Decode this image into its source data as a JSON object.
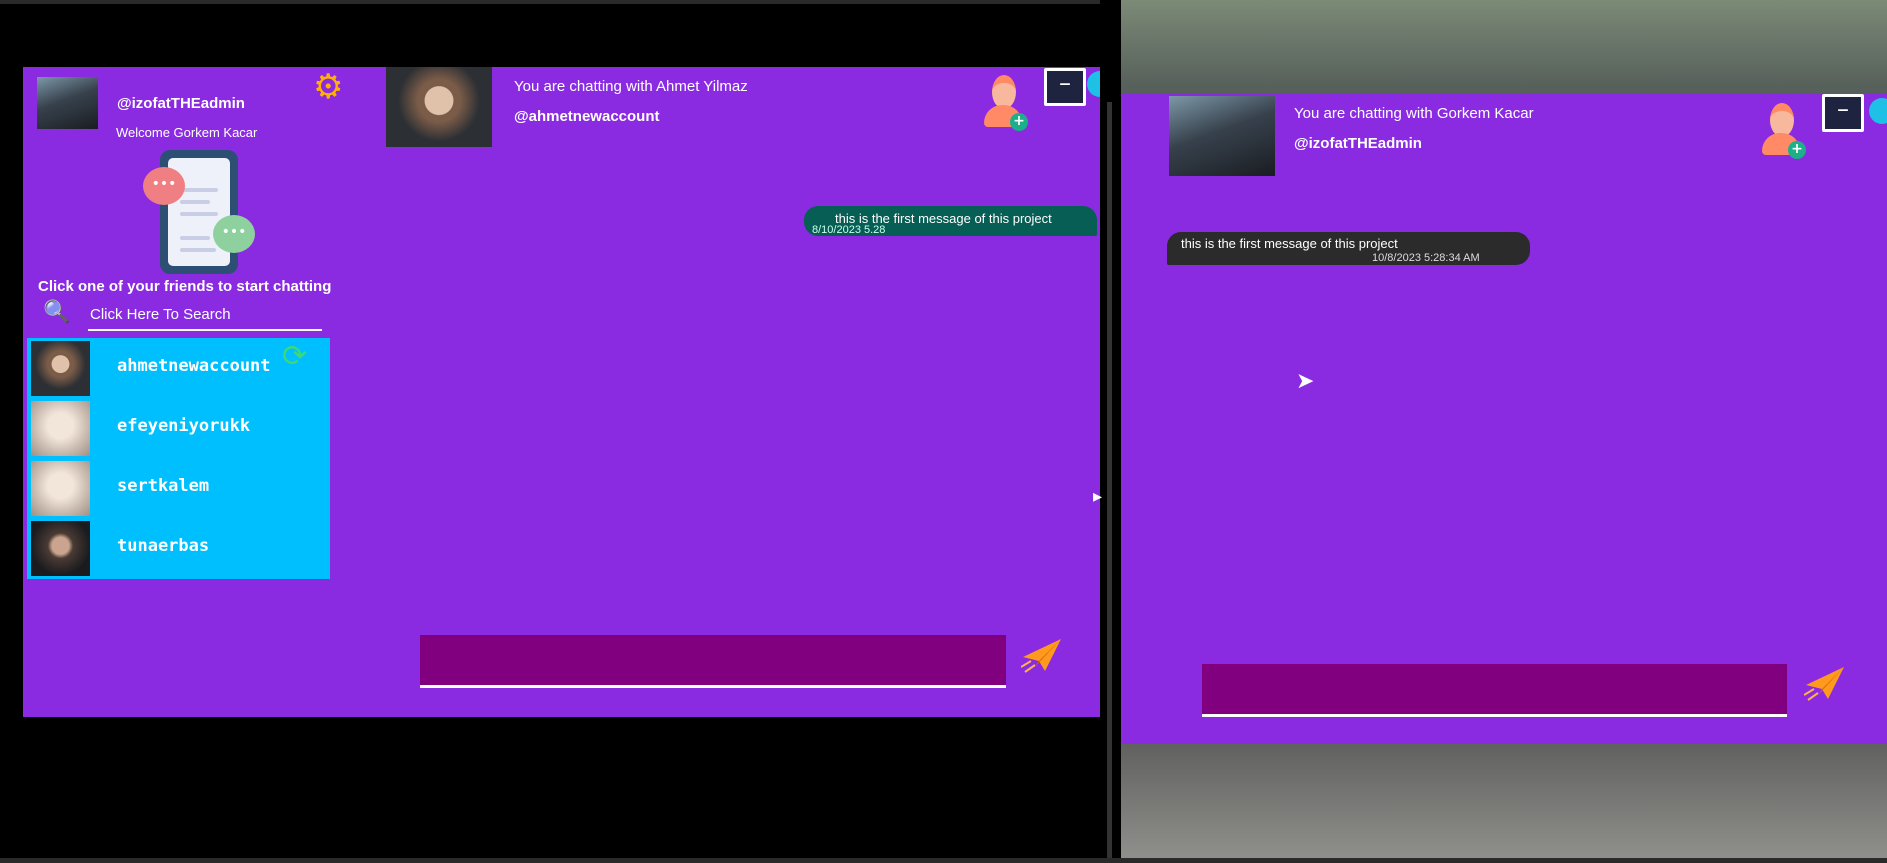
{
  "left_window": {
    "current_user": {
      "handle": "@izofatTHEadmin",
      "welcome": "Welcome Gorkem Kacar"
    },
    "instruction": "Click one of your friends to start chatting",
    "search": {
      "placeholder": "Click Here To Search"
    },
    "friends": [
      {
        "username": "ahmetnewaccount"
      },
      {
        "username": "efeyeniyorukk"
      },
      {
        "username": "sertkalem"
      },
      {
        "username": "tunaerbas"
      }
    ],
    "chat": {
      "title": "You are chatting with Ahmet Yilmaz",
      "handle": "@ahmetnewaccount",
      "messages": [
        {
          "text": "this is the first message of this project",
          "timestamp": "8/10/2023 5.28"
        }
      ]
    }
  },
  "right_window": {
    "chat": {
      "title": "You are chatting with Gorkem Kacar",
      "handle": "@izofatTHEadmin",
      "messages": [
        {
          "text": "this is the first message of this project",
          "timestamp": "10/8/2023 5:28:34 AM"
        }
      ]
    }
  },
  "icons": {
    "gear": "gear-icon",
    "search": "search-icon",
    "refresh": "refresh-icon",
    "add_user": "add-user-icon",
    "minimize": "minimize-icon",
    "send": "send-plane-icon"
  },
  "colors": {
    "window_bg": "#8a2be2",
    "friend_list_bg": "#00bfff",
    "composer_bg": "#800080",
    "outgoing_bubble": "#075e54",
    "incoming_bubble": "#2b2b2b"
  }
}
